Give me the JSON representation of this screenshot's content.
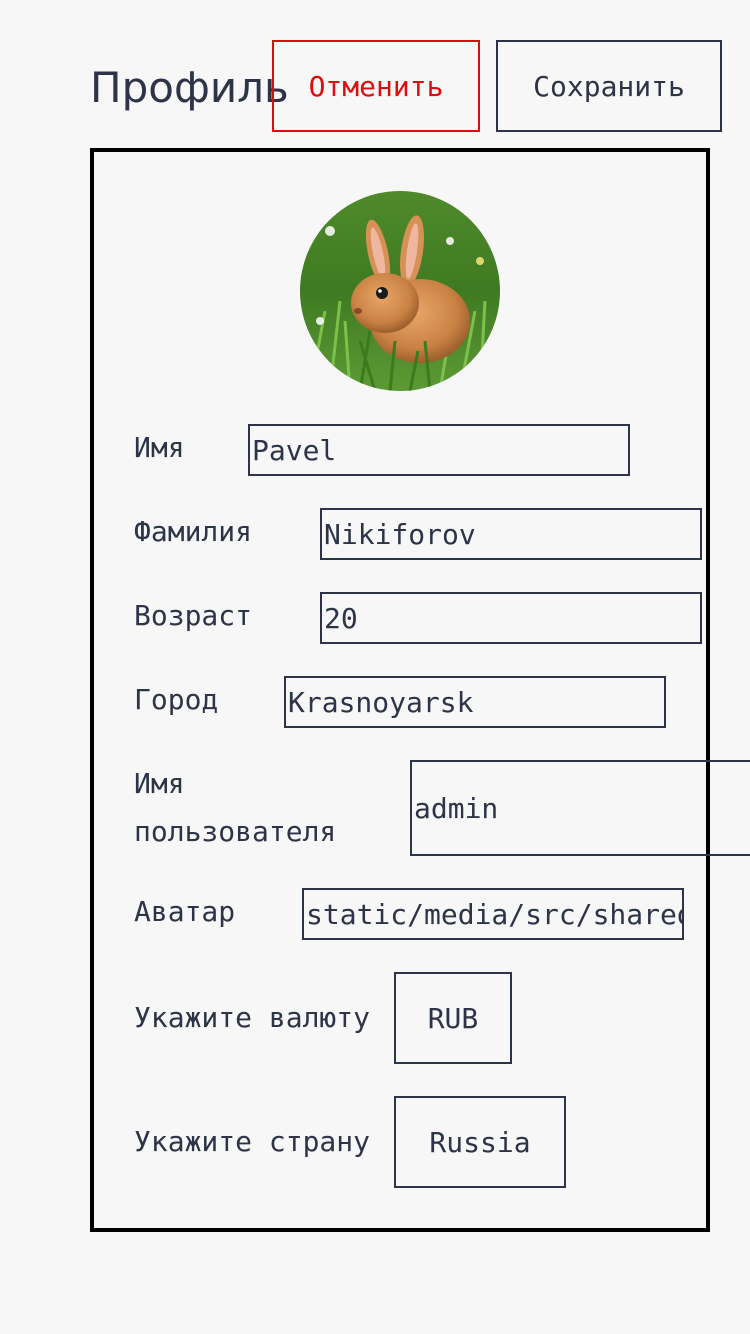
{
  "header": {
    "title": "Профиль",
    "cancel_label": "Отменить",
    "save_label": "Сохранить"
  },
  "colors": {
    "text": "#2d3447",
    "cancel": "#dd0d0d",
    "background": "#f7f7f7",
    "card_border": "#000000"
  },
  "profile": {
    "avatar_icon": "rabbit-avatar-image",
    "fields": {
      "first_name": {
        "label": "Имя",
        "value": "Pavel"
      },
      "last_name": {
        "label": "Фамилия",
        "value": "Nikiforov"
      },
      "age": {
        "label": "Возраст",
        "value": "20"
      },
      "city": {
        "label": "Город",
        "value": "Krasnoyarsk"
      },
      "username": {
        "label_line1": "Имя",
        "label_line2": "пользователя",
        "value": "admin"
      },
      "avatar": {
        "label": "Аватар",
        "value": "static/media/src/shared/assets/tests/storybook.jpg"
      }
    },
    "currency": {
      "label": "Укажите валюту",
      "value": "RUB"
    },
    "country": {
      "label": "Укажите страну",
      "value": "Russia"
    }
  }
}
